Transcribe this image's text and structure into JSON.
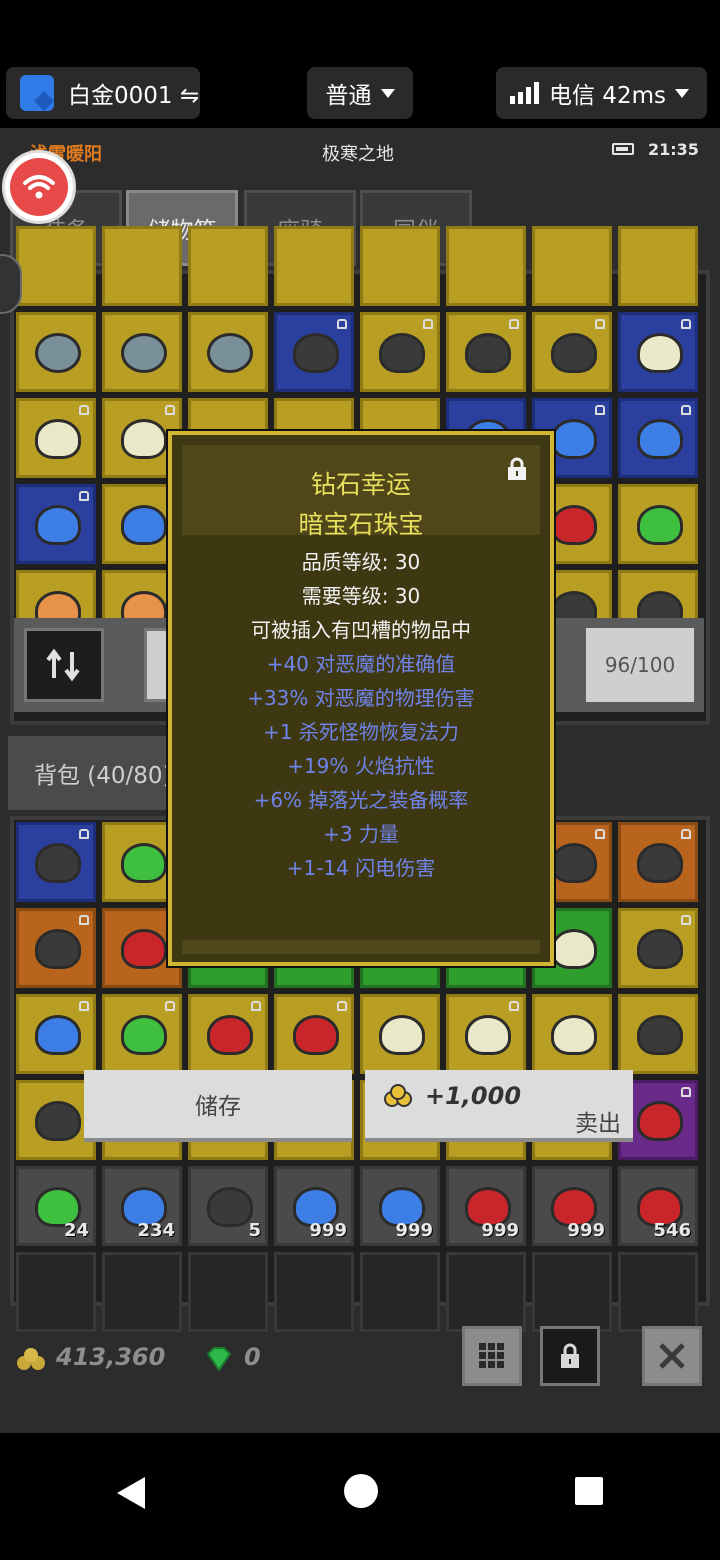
{
  "overlay": {
    "account_label": "白金0001 ⇋",
    "mode_label": "普通",
    "network_label": "电信 42ms"
  },
  "status": {
    "player_name": "浅雪暖阳",
    "zone_name": "极寒之地",
    "clock": "21:35"
  },
  "tabs": [
    {
      "label": "装备",
      "active": false
    },
    {
      "label": "储物箱",
      "active": true
    },
    {
      "label": "座骑",
      "active": false
    },
    {
      "label": "同伴",
      "active": false
    }
  ],
  "storage": {
    "capacity": "96/100"
  },
  "bag": {
    "label": "背包 (40/80)",
    "stacks": [
      "24",
      "234",
      "5",
      "999",
      "999",
      "999",
      "999",
      "546"
    ]
  },
  "tooltip": {
    "name": "钻石幸运",
    "type": "暗宝石珠宝",
    "lines_white": [
      "品质等级: 30",
      "需要等级: 30",
      "可被插入有凹槽的物品中"
    ],
    "lines_blue": [
      "+40 对恶魔的准确值",
      "+33% 对恶魔的物理伤害",
      "+1 杀死怪物恢复法力",
      "+19% 火焰抗性",
      "+6% 掉落光之装备概率",
      "+3 力量",
      "+1-14 闪电伤害"
    ]
  },
  "actions": {
    "store_label": "储存",
    "sell_price": "+1,000",
    "sell_label": "卖出"
  },
  "footer": {
    "gold": "413,360",
    "diamonds": "0"
  },
  "colors": {
    "tooltip_title": "#e8df5c",
    "tooltip_affix": "#6f83e8",
    "player_name": "#e07a1f"
  }
}
